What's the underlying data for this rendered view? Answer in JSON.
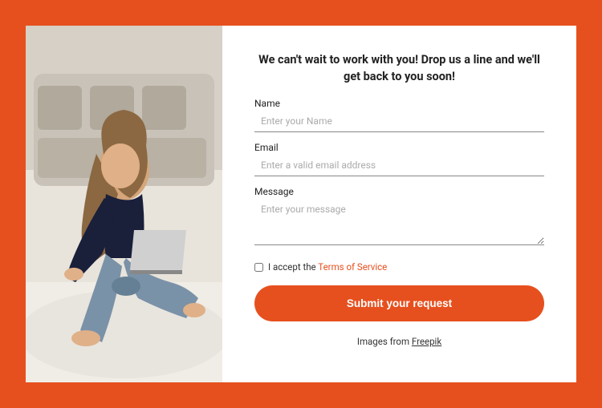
{
  "heading": "We can't wait to work with you! Drop us a line and we'll get back to you soon!",
  "fields": {
    "name": {
      "label": "Name",
      "placeholder": "Enter your Name"
    },
    "email": {
      "label": "Email",
      "placeholder": "Enter a valid email address"
    },
    "message": {
      "label": "Message",
      "placeholder": "Enter your message"
    }
  },
  "terms": {
    "prefix": "I accept the ",
    "link": "Terms of Service"
  },
  "submit": "Submit your request",
  "credit": {
    "prefix": "Images from ",
    "link": "Freepik"
  }
}
